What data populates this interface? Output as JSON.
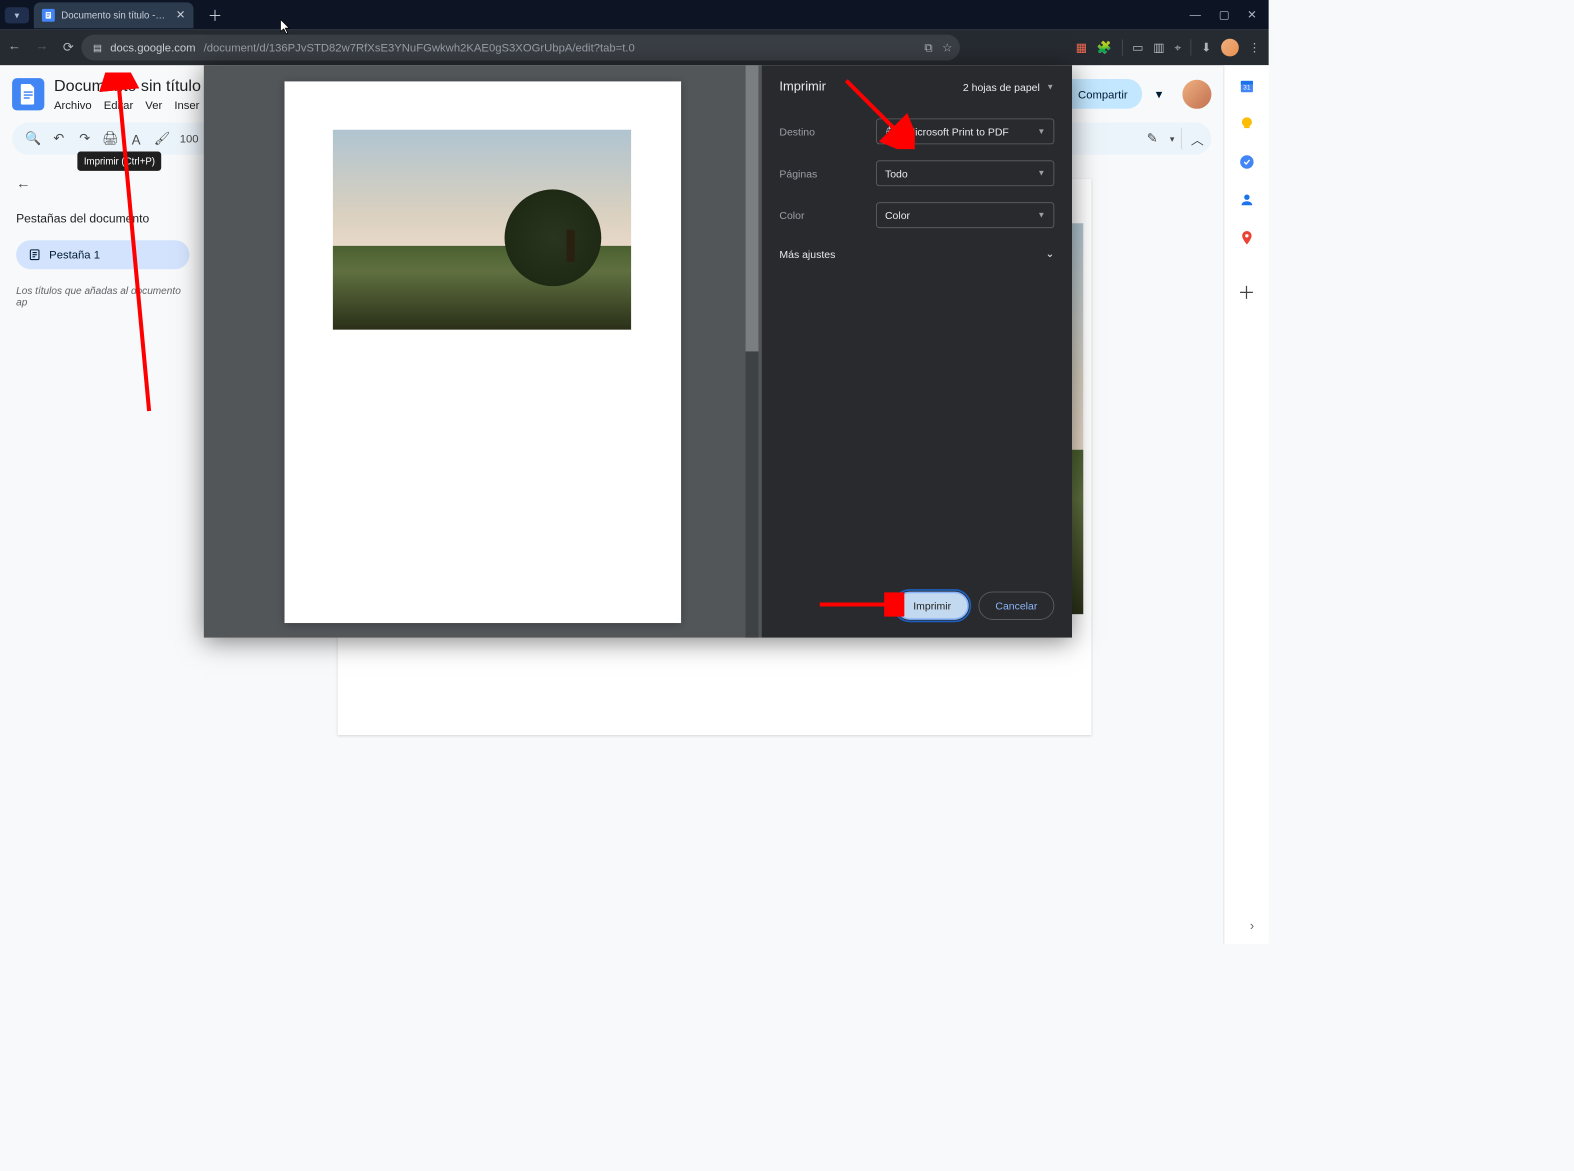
{
  "browser": {
    "tab_title": "Documento sin título - Docume",
    "url_site": "docs.google.com",
    "url_path": "/document/d/136PJvSTD82w7RfXsE3YNuFGwkwh2KAE0gS3XOGrUbpA/edit?tab=t.0"
  },
  "docs": {
    "title": "Documento sin título",
    "menus": {
      "file": "Archivo",
      "edit": "Editar",
      "view": "Ver",
      "insert": "Inser"
    },
    "share_label": "Compartir",
    "zoom": "100",
    "tooltip": "Imprimir (Ctrl+P)"
  },
  "sidebar": {
    "heading": "Pestañas del documento",
    "tab1": "Pestaña 1",
    "help": "Los títulos que añadas al documento ap"
  },
  "print": {
    "title": "Imprimir",
    "sheets": "2 hojas de papel",
    "rows": {
      "destination": {
        "label": "Destino",
        "value": "Microsoft Print to PDF"
      },
      "pages": {
        "label": "Páginas",
        "value": "Todo"
      },
      "color": {
        "label": "Color",
        "value": "Color"
      }
    },
    "more": "Más ajustes",
    "print_btn": "Imprimir",
    "cancel_btn": "Cancelar"
  }
}
